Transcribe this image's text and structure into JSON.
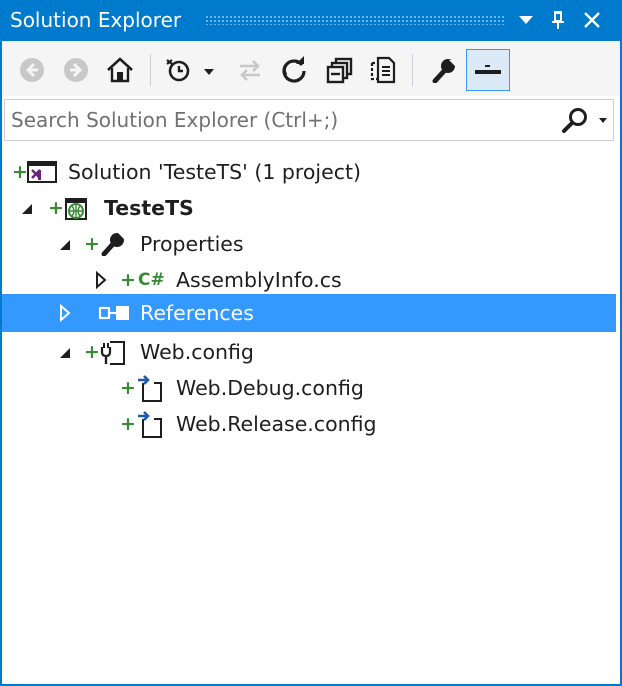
{
  "window": {
    "title": "Solution Explorer"
  },
  "toolbar": {
    "buttons": [
      "back-icon",
      "forward-icon",
      "home-icon",
      "pending-changes-filter-icon",
      "sync-with-active-document-icon",
      "refresh-icon",
      "collapse-all-icon",
      "show-all-files-icon",
      "properties-icon",
      "preview-selected-items-icon"
    ]
  },
  "search": {
    "placeholder": "Search Solution Explorer (Ctrl+;)",
    "value": ""
  },
  "tree": {
    "solution": "Solution 'TesteTS' (1 project)",
    "project": "TesteTS",
    "properties": "Properties",
    "assemblyinfo": "AssemblyInfo.cs",
    "references": "References",
    "webconfig": "Web.config",
    "webdebug": "Web.Debug.config",
    "webrelease": "Web.Release.config"
  },
  "colors": {
    "accent": "#007acc",
    "selection": "#3399ff",
    "added_plus": "#388a34"
  }
}
